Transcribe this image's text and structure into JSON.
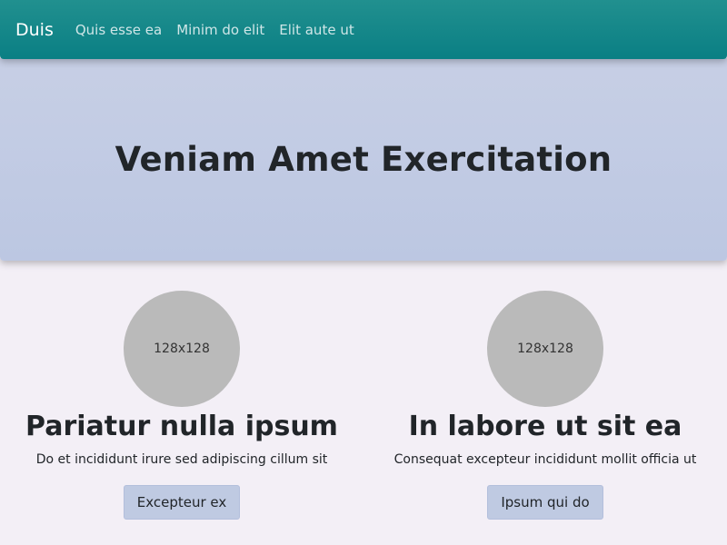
{
  "navbar": {
    "brand": "Duis",
    "links": [
      "Quis esse ea",
      "Minim do elit",
      "Elit aute ut"
    ]
  },
  "hero": {
    "title": "Veniam Amet Exercitation"
  },
  "features": [
    {
      "image_label": "128x128",
      "title": "Pariatur nulla ipsum",
      "text": "Do et incididunt irure sed adipiscing cillum sit",
      "button": "Excepteur ex"
    },
    {
      "image_label": "128x128",
      "title": "In labore ut sit ea",
      "text": "Consequat excepteur incididunt mollit officia ut",
      "button": "Ipsum qui do"
    }
  ],
  "colors": {
    "navbar": "#138786",
    "hero": "#c2cbe3",
    "page_background": "#f3eff6",
    "button": "#bfcae2",
    "placeholder": "#bababa"
  }
}
